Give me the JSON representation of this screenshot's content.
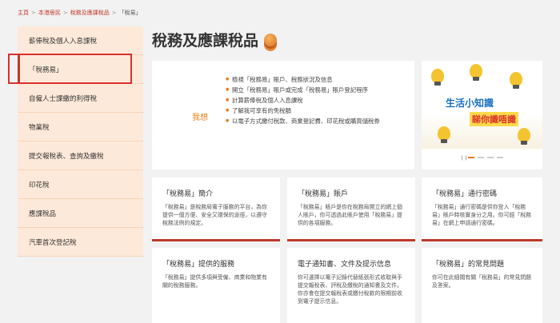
{
  "breadcrumb": {
    "home": "主頁",
    "item1": "本港居民",
    "item2": "稅務及應課稅品",
    "current": "「稅易」",
    "sep": ">"
  },
  "sidebar": {
    "items": [
      {
        "label": "薪俸稅及個人入息課稅"
      },
      {
        "label": "「稅務易」"
      },
      {
        "label": "自僱人士課繳的利得稅"
      },
      {
        "label": "物業稅"
      },
      {
        "label": "提交報稅表、查詢及繳稅"
      },
      {
        "label": "印花稅"
      },
      {
        "label": "應課稅品"
      },
      {
        "label": "汽車首次登記稅"
      }
    ]
  },
  "page": {
    "title": "稅務及應課稅品"
  },
  "want": {
    "label": "我想",
    "items": [
      "檢視「稅務易」賬戶、稅務狀況及信息",
      "開立「稅務易」賬戶或完成「稅務易」賬戶登記程序",
      "計算薪俸稅及個人入息課稅",
      "了解我可享有的免稅額",
      "以電子方式繳付稅款、商業登記費、印花稅或購買儲稅券"
    ]
  },
  "banner": {
    "line1": "生活小知識",
    "line2": "睇你識唔識"
  },
  "cards": [
    {
      "title": "「稅務易」簡介",
      "desc": "「稅務易」是稅務局電子服務的平台，為你提供一個方便、安全又環保的途徑，以遵守稅務法例的規定。"
    },
    {
      "title": "「稅務易」賬戶",
      "desc": "「稅務易」賬戶是你在稅務局開立的網上個人賬戶，你可透過此賬戶使用「稅務易」提供的各項服務。"
    },
    {
      "title": "「稅務易」通行密碼",
      "desc": "「稅務易」通行密碼是供你登入「稅務易」賬戶時核實身分之用。你可經「稅務易」在網上申請通行密碼。"
    },
    {
      "title": "「稅務易」提供的服務",
      "desc": "「稅務易」提供多項與受僱、商業和物業有關的稅務服務。"
    },
    {
      "title": "電子通知書、文件及提示信息",
      "desc": "你可選擇以電子記錄代替紙張形式收取與手提交報稅表、評稅及繳稅的通知書及文件。你亦會在提交報稅表或繳付稅款的限期前收到電子提示信息。"
    },
    {
      "title": "「稅務易」的常見問題",
      "desc": "你可在此細閱有關「稅務易」的常見問題及答案。"
    }
  ],
  "colors": {
    "accent": "#c0392b",
    "orange": "#e67e22",
    "sidebar_bg": "#fde9d9"
  }
}
